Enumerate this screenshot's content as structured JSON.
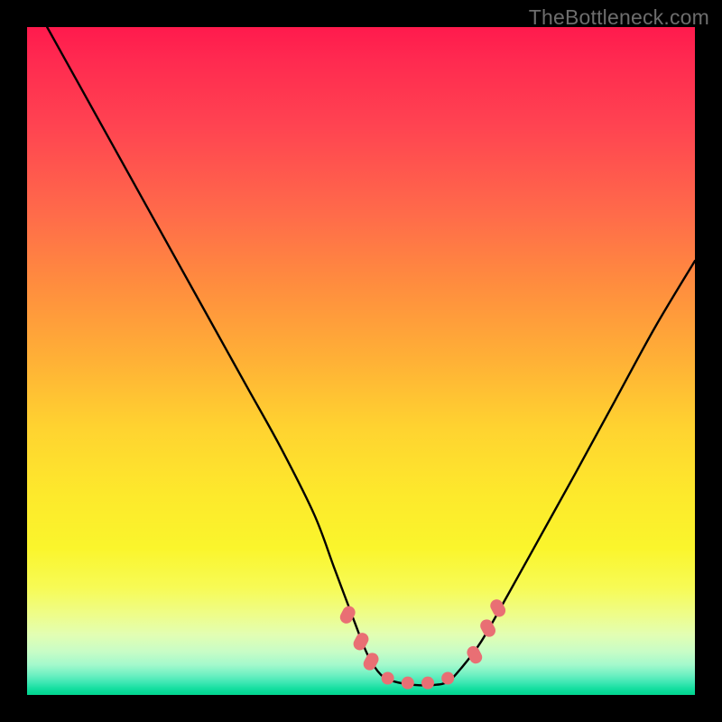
{
  "watermark": {
    "text": "TheBottleneck.com"
  },
  "chart_data": {
    "type": "line",
    "title": "",
    "xlabel": "",
    "ylabel": "",
    "xlim": [
      0,
      100
    ],
    "ylim": [
      0,
      100
    ],
    "grid": false,
    "legend": "none",
    "background_gradient": {
      "orientation": "vertical",
      "stops": [
        {
          "pos": 0,
          "color": "#ff1a4d"
        },
        {
          "pos": 50,
          "color": "#ffb136"
        },
        {
          "pos": 78,
          "color": "#faf52c"
        },
        {
          "pos": 100,
          "color": "#03d690"
        }
      ]
    },
    "series": [
      {
        "name": "bottleneck-curve",
        "color": "#000000",
        "x": [
          3,
          8,
          13,
          18,
          23,
          28,
          33,
          38,
          43,
          46,
          49,
          51,
          53,
          55,
          58,
          61,
          63,
          65,
          68,
          72,
          77,
          82,
          88,
          94,
          100
        ],
        "y": [
          100,
          91,
          82,
          73,
          64,
          55,
          46,
          37,
          27,
          19,
          11,
          6,
          3,
          2,
          1.5,
          1.5,
          2,
          4,
          8,
          15,
          24,
          33,
          44,
          55,
          65
        ]
      }
    ],
    "markers": [
      {
        "name": "highlight-dots",
        "shape": "round",
        "color": "#e96f74",
        "points": [
          {
            "x": 48,
            "y": 12
          },
          {
            "x": 50,
            "y": 8
          },
          {
            "x": 51.5,
            "y": 5
          },
          {
            "x": 54,
            "y": 2.5
          },
          {
            "x": 57,
            "y": 1.8
          },
          {
            "x": 60,
            "y": 1.8
          },
          {
            "x": 63,
            "y": 2.5
          },
          {
            "x": 67,
            "y": 6
          },
          {
            "x": 69,
            "y": 10
          },
          {
            "x": 70.5,
            "y": 13
          }
        ]
      }
    ]
  }
}
